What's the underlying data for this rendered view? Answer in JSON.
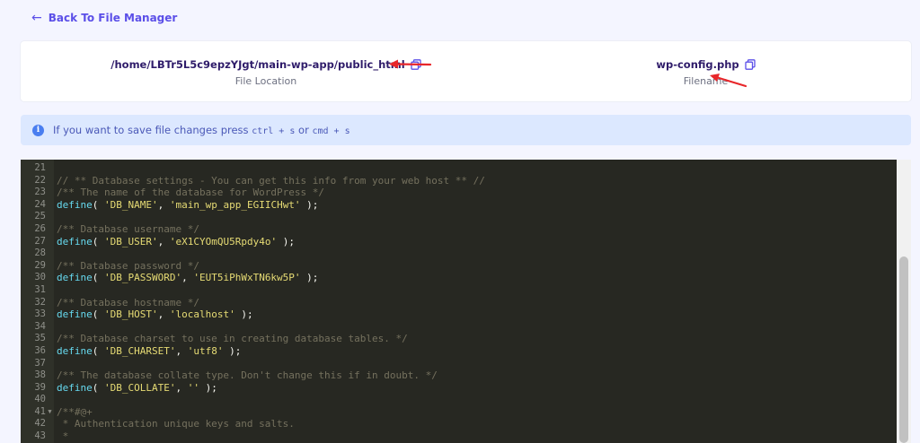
{
  "nav": {
    "back_label": "Back To File Manager"
  },
  "file_info": {
    "location_value": "/home/LBTr5L5c9epzYJgt/main-wp-app/public_html",
    "location_label": "File Location",
    "filename_value": "wp-config.php",
    "filename_label": "Filename"
  },
  "alert": {
    "text_before": "If you want to save file changes press",
    "shortcut_1": "ctrl + s",
    "text_or": "or",
    "shortcut_2": "cmd + s"
  },
  "editor": {
    "lines": [
      {
        "n": "21",
        "fold": "",
        "parts": []
      },
      {
        "n": "22",
        "fold": "",
        "parts": [
          {
            "t": "comment",
            "v": "// ** Database settings - You can get this info from your web host ** //"
          }
        ]
      },
      {
        "n": "23",
        "fold": "",
        "parts": [
          {
            "t": "comment",
            "v": "/** The name of the database for WordPress */"
          }
        ]
      },
      {
        "n": "24",
        "fold": "",
        "parts": [
          {
            "t": "fn",
            "v": "define"
          },
          {
            "t": "punc",
            "v": "( "
          },
          {
            "t": "str",
            "v": "'DB_NAME'"
          },
          {
            "t": "punc",
            "v": ", "
          },
          {
            "t": "str",
            "v": "'main_wp_app_EGIICHwt'"
          },
          {
            "t": "punc",
            "v": " );"
          }
        ]
      },
      {
        "n": "25",
        "fold": "",
        "parts": []
      },
      {
        "n": "26",
        "fold": "",
        "parts": [
          {
            "t": "comment",
            "v": "/** Database username */"
          }
        ]
      },
      {
        "n": "27",
        "fold": "",
        "parts": [
          {
            "t": "fn",
            "v": "define"
          },
          {
            "t": "punc",
            "v": "( "
          },
          {
            "t": "str",
            "v": "'DB_USER'"
          },
          {
            "t": "punc",
            "v": ", "
          },
          {
            "t": "str",
            "v": "'eX1CYOmQU5Rpdy4o'"
          },
          {
            "t": "punc",
            "v": " );"
          }
        ]
      },
      {
        "n": "28",
        "fold": "",
        "parts": []
      },
      {
        "n": "29",
        "fold": "",
        "parts": [
          {
            "t": "comment",
            "v": "/** Database password */"
          }
        ]
      },
      {
        "n": "30",
        "fold": "",
        "parts": [
          {
            "t": "fn",
            "v": "define"
          },
          {
            "t": "punc",
            "v": "( "
          },
          {
            "t": "str",
            "v": "'DB_PASSWORD'"
          },
          {
            "t": "punc",
            "v": ", "
          },
          {
            "t": "str",
            "v": "'EUT5iPhWxTN6kw5P'"
          },
          {
            "t": "punc",
            "v": " );"
          }
        ]
      },
      {
        "n": "31",
        "fold": "",
        "parts": []
      },
      {
        "n": "32",
        "fold": "",
        "parts": [
          {
            "t": "comment",
            "v": "/** Database hostname */"
          }
        ]
      },
      {
        "n": "33",
        "fold": "",
        "parts": [
          {
            "t": "fn",
            "v": "define"
          },
          {
            "t": "punc",
            "v": "( "
          },
          {
            "t": "str",
            "v": "'DB_HOST'"
          },
          {
            "t": "punc",
            "v": ", "
          },
          {
            "t": "str",
            "v": "'localhost'"
          },
          {
            "t": "punc",
            "v": " );"
          }
        ]
      },
      {
        "n": "34",
        "fold": "",
        "parts": []
      },
      {
        "n": "35",
        "fold": "",
        "parts": [
          {
            "t": "comment",
            "v": "/** Database charset to use in creating database tables. */"
          }
        ]
      },
      {
        "n": "36",
        "fold": "",
        "parts": [
          {
            "t": "fn",
            "v": "define"
          },
          {
            "t": "punc",
            "v": "( "
          },
          {
            "t": "str",
            "v": "'DB_CHARSET'"
          },
          {
            "t": "punc",
            "v": ", "
          },
          {
            "t": "str",
            "v": "'utf8'"
          },
          {
            "t": "punc",
            "v": " );"
          }
        ]
      },
      {
        "n": "37",
        "fold": "",
        "parts": []
      },
      {
        "n": "38",
        "fold": "",
        "parts": [
          {
            "t": "comment",
            "v": "/** The database collate type. Don't change this if in doubt. */"
          }
        ]
      },
      {
        "n": "39",
        "fold": "",
        "parts": [
          {
            "t": "fn",
            "v": "define"
          },
          {
            "t": "punc",
            "v": "( "
          },
          {
            "t": "str",
            "v": "'DB_COLLATE'"
          },
          {
            "t": "punc",
            "v": ", "
          },
          {
            "t": "str",
            "v": "''"
          },
          {
            "t": "punc",
            "v": " );"
          }
        ]
      },
      {
        "n": "40",
        "fold": "",
        "parts": []
      },
      {
        "n": "41",
        "fold": "▼",
        "parts": [
          {
            "t": "comment",
            "v": "/**#@+"
          }
        ]
      },
      {
        "n": "42",
        "fold": "",
        "parts": [
          {
            "t": "comment",
            "v": " * Authentication unique keys and salts."
          }
        ]
      },
      {
        "n": "43",
        "fold": "",
        "parts": [
          {
            "t": "comment",
            "v": " *"
          }
        ]
      }
    ]
  },
  "colors": {
    "accent": "#5b4fe8",
    "editor_bg": "#272822",
    "annotation_arrow": "#e8262a"
  }
}
